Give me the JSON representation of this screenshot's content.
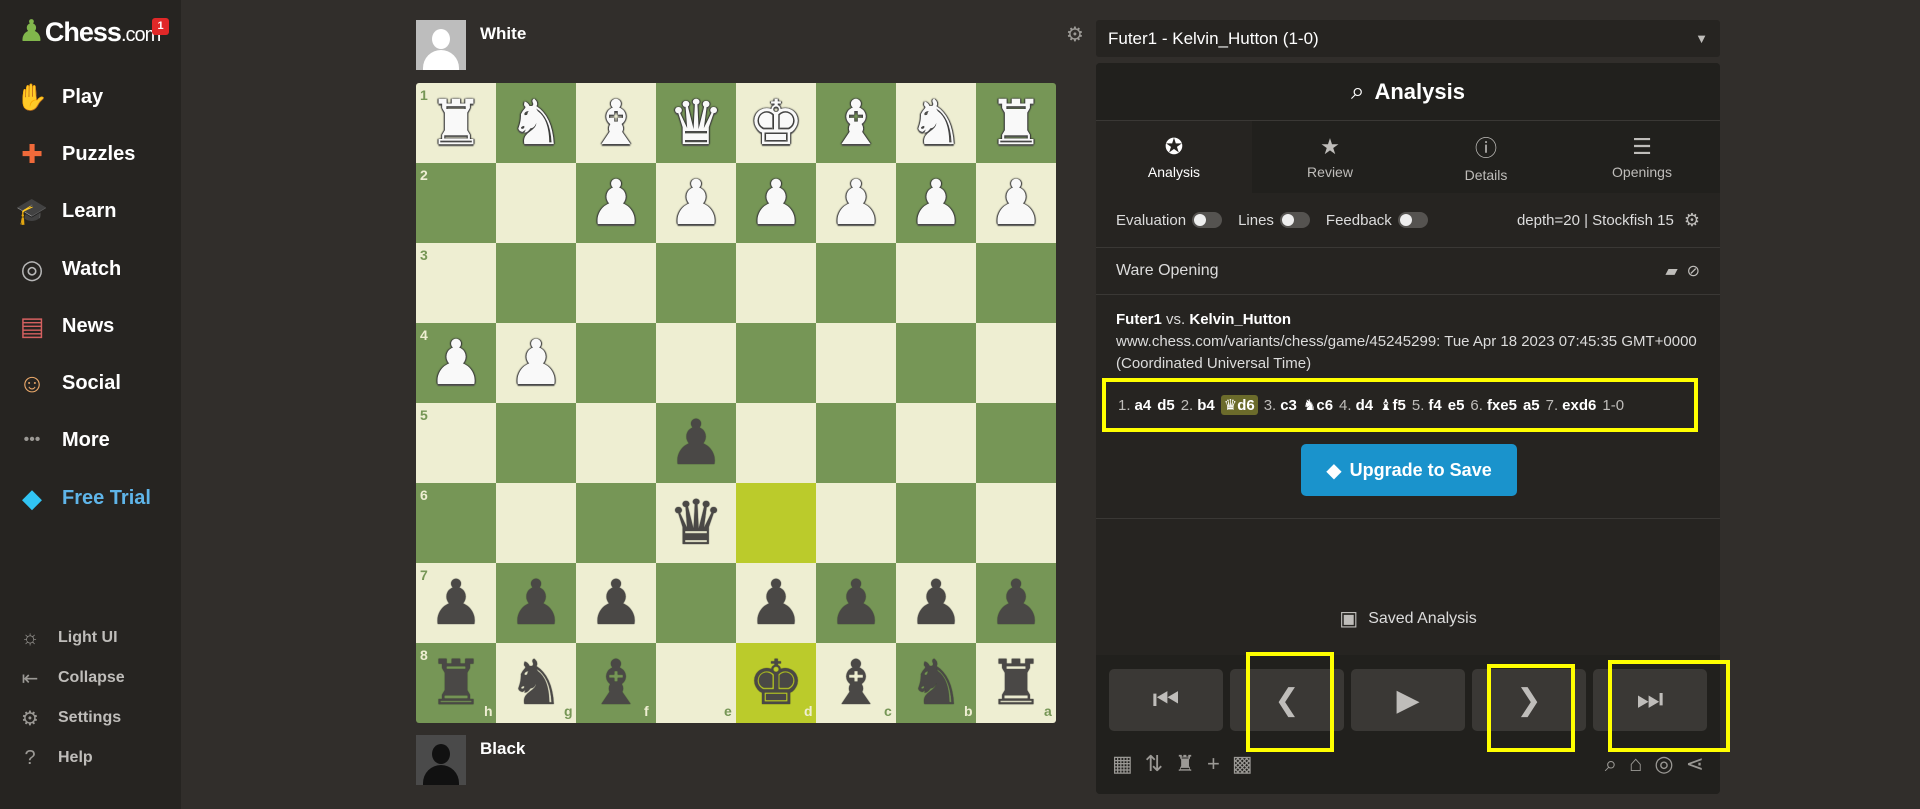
{
  "logo": {
    "pawn": "♟",
    "word": "Chess",
    "suffix": ".com",
    "badge": "1"
  },
  "nav": [
    {
      "name": "nav-play",
      "icon": "play-icon",
      "glyph": "✋",
      "color": "#e4a76f",
      "label": "Play"
    },
    {
      "name": "nav-puzzles",
      "icon": "puzzle-icon",
      "glyph": "✚",
      "color": "#f06a3a",
      "label": "Puzzles"
    },
    {
      "name": "nav-learn",
      "icon": "graduation-cap-icon",
      "glyph": "🎓",
      "color": "#3a8fd6",
      "label": "Learn"
    },
    {
      "name": "nav-watch",
      "icon": "binoculars-icon",
      "glyph": "◎",
      "color": "#b7b7b7",
      "label": "Watch"
    },
    {
      "name": "nav-news",
      "icon": "newspaper-icon",
      "glyph": "▤",
      "color": "#d46060",
      "label": "News"
    },
    {
      "name": "nav-social",
      "icon": "social-icon",
      "glyph": "☺",
      "color": "#e9a86a",
      "label": "Social"
    },
    {
      "name": "nav-more",
      "icon": "more-icon",
      "glyph": "•••",
      "color": "#9b9995",
      "label": "More"
    },
    {
      "name": "nav-free-trial",
      "icon": "diamond-icon",
      "glyph": "◆",
      "color": "#31c4f3",
      "label": "Free Trial"
    }
  ],
  "footer": [
    {
      "name": "footer-light-ui",
      "icon": "sun-icon",
      "glyph": "☼",
      "label": "Light UI"
    },
    {
      "name": "footer-collapse",
      "icon": "collapse-icon",
      "glyph": "⇤",
      "label": "Collapse"
    },
    {
      "name": "footer-settings",
      "icon": "gear-icon",
      "glyph": "⚙",
      "label": "Settings"
    },
    {
      "name": "footer-help",
      "icon": "help-icon",
      "glyph": "?",
      "label": "Help"
    }
  ],
  "players": {
    "top": "White",
    "bottom": "Black"
  },
  "board": {
    "rank_labels": [
      "1",
      "2",
      "3",
      "4",
      "5",
      "6",
      "7",
      "8"
    ],
    "file_labels": [
      "h",
      "g",
      "f",
      "e",
      "d",
      "c",
      "b",
      "a"
    ],
    "light_color": "#eeeed2",
    "dark_color": "#769656",
    "highlight_color": "#bbcb2b",
    "highlights": [
      "d6",
      "d8"
    ],
    "pieces": [
      {
        "square": "a1",
        "piece": "♜",
        "side": "w"
      },
      {
        "square": "b1",
        "piece": "♞",
        "side": "w"
      },
      {
        "square": "c1",
        "piece": "♝",
        "side": "w"
      },
      {
        "square": "d1",
        "piece": "♚",
        "side": "w"
      },
      {
        "square": "e1",
        "piece": "♛",
        "side": "w"
      },
      {
        "square": "f1",
        "piece": "♝",
        "side": "w"
      },
      {
        "square": "g1",
        "piece": "♞",
        "side": "w"
      },
      {
        "square": "h1",
        "piece": "♜",
        "side": "w"
      },
      {
        "square": "a2",
        "piece": "♟",
        "side": "w"
      },
      {
        "square": "b2",
        "piece": "♟",
        "side": "w"
      },
      {
        "square": "c2",
        "piece": "♟",
        "side": "w"
      },
      {
        "square": "d2",
        "piece": "♟",
        "side": "w"
      },
      {
        "square": "e2",
        "piece": "♟",
        "side": "w"
      },
      {
        "square": "f2",
        "piece": "♟",
        "side": "w"
      },
      {
        "square": "g4",
        "piece": "♟",
        "side": "w"
      },
      {
        "square": "h4",
        "piece": "♟",
        "side": "w"
      },
      {
        "square": "e5",
        "piece": "♟",
        "side": "b"
      },
      {
        "square": "e6",
        "piece": "♛",
        "side": "b"
      },
      {
        "square": "a7",
        "piece": "♟",
        "side": "b"
      },
      {
        "square": "b7",
        "piece": "♟",
        "side": "b"
      },
      {
        "square": "c7",
        "piece": "♟",
        "side": "b"
      },
      {
        "square": "d7",
        "piece": "♟",
        "side": "b"
      },
      {
        "square": "f7",
        "piece": "♟",
        "side": "b"
      },
      {
        "square": "g7",
        "piece": "♟",
        "side": "b"
      },
      {
        "square": "h7",
        "piece": "♟",
        "side": "b"
      },
      {
        "square": "a8",
        "piece": "♜",
        "side": "b"
      },
      {
        "square": "b8",
        "piece": "♞",
        "side": "b"
      },
      {
        "square": "c8",
        "piece": "♝",
        "side": "b"
      },
      {
        "square": "d8",
        "piece": "♚",
        "side": "b"
      },
      {
        "square": "f8",
        "piece": "♝",
        "side": "b"
      },
      {
        "square": "g8",
        "piece": "♞",
        "side": "b"
      },
      {
        "square": "h8",
        "piece": "♜",
        "side": "b"
      }
    ]
  },
  "game_select": {
    "label": "Futer1 - Kelvin_Hutton (1-0)",
    "chevron": "▼"
  },
  "panel": {
    "title": "Analysis",
    "tabs": [
      {
        "name": "tab-analysis",
        "icon": "analysis-icon",
        "glyph": "✪",
        "label": "Analysis",
        "active": true
      },
      {
        "name": "tab-review",
        "icon": "star-icon",
        "glyph": "★",
        "label": "Review",
        "active": false
      },
      {
        "name": "tab-details",
        "icon": "info-icon",
        "glyph": "ⓘ",
        "label": "Details",
        "active": false
      },
      {
        "name": "tab-openings",
        "icon": "book-stack-icon",
        "glyph": "☰",
        "label": "Openings",
        "active": false
      }
    ],
    "toggles": [
      {
        "name": "toggle-evaluation",
        "label": "Evaluation"
      },
      {
        "name": "toggle-lines",
        "label": "Lines"
      },
      {
        "name": "toggle-feedback",
        "label": "Feedback"
      }
    ],
    "engine": "depth=20 | Stockfish 15",
    "opening": "Ware Opening",
    "header": {
      "white": "Futer1",
      "vs": " vs. ",
      "black": "Kelvin_Hutton",
      "line": "www.chess.com/variants/chess/game/45245299: Tue Apr 18 2023 07:45:35 GMT+0000 (Coordinated Universal Time)"
    },
    "moves": [
      {
        "num": "1.",
        "white": "a4",
        "black": "d5"
      },
      {
        "num": "2.",
        "white": "b4",
        "black": "♛d6"
      },
      {
        "num": "3.",
        "white": "c3",
        "black": "♞c6"
      },
      {
        "num": "4.",
        "white": "d4",
        "black": "♝f5"
      },
      {
        "num": "5.",
        "white": "f4",
        "black": "e5"
      },
      {
        "num": "6.",
        "white": "fxe5",
        "black": "a5"
      },
      {
        "num": "7.",
        "white": "exd6",
        "black": ""
      }
    ],
    "result": "1-0",
    "current_move": "♛d6",
    "upgrade_label": "Upgrade to Save",
    "saved_label": "Saved Analysis",
    "controls": [
      {
        "name": "first-move-button",
        "icon": "skip-start-icon",
        "glyph": "⏮"
      },
      {
        "name": "previous-move-button",
        "icon": "chevron-left-icon",
        "glyph": "❮"
      },
      {
        "name": "play-button",
        "icon": "play-icon",
        "glyph": "▶"
      },
      {
        "name": "next-move-button",
        "icon": "chevron-right-icon",
        "glyph": "❯"
      },
      {
        "name": "last-move-button",
        "icon": "skip-end-icon",
        "glyph": "⏭"
      }
    ],
    "tools_left": [
      {
        "name": "eval-graph-icon",
        "glyph": "▦"
      },
      {
        "name": "flip-board-icon",
        "glyph": "⇅"
      },
      {
        "name": "piece-style-icon",
        "glyph": "♜"
      },
      {
        "name": "add-icon",
        "glyph": "+"
      },
      {
        "name": "board-setup-icon",
        "glyph": "▩"
      }
    ],
    "tools_right": [
      {
        "name": "analysis-zoom-icon",
        "glyph": "⌕"
      },
      {
        "name": "library-icon",
        "glyph": "⌂"
      },
      {
        "name": "target-icon",
        "glyph": "◎"
      },
      {
        "name": "share-icon",
        "glyph": "⋖"
      }
    ]
  },
  "highlight_box_color": "#ffff00"
}
